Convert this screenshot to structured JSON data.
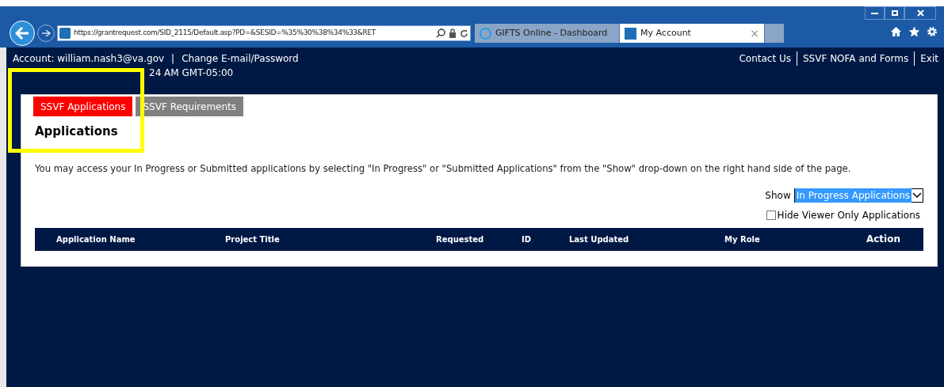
{
  "browser": {
    "url": "https://grantrequest.com/SID_2115/Default.asp?PD=&SESID=%35%30%38%34%33&RET",
    "tabs": [
      {
        "title": "GIFTS Online - Dashboard",
        "selected": false
      },
      {
        "title": "My Account",
        "selected": true
      }
    ],
    "close_tab": "×"
  },
  "header": {
    "account": "Account: william.nash3@va.gov",
    "separator": "|",
    "change_link": "Change E-mail/Password",
    "last_login": "24 AM GMT-05:00",
    "links": [
      "Contact Us",
      "SSVF NOFA and Forms",
      "Exit"
    ]
  },
  "tabs": [
    {
      "label": "SSVF Applications",
      "selected": true
    },
    {
      "label": "SSVF Requirements",
      "selected": false
    }
  ],
  "heading": "Applications",
  "instructions": "You may access your In Progress or Submitted applications by selecting \"In Progress\" or \"Submitted Applications\" from the \"Show\" drop-down on the right hand side of the page.",
  "show": {
    "label": "Show",
    "value": "In Progress Applications"
  },
  "hide_viewer": {
    "label": "Hide Viewer Only Applications",
    "checked": false
  },
  "table": {
    "columns": [
      "Application Name",
      "Project Title",
      "Requested",
      "ID",
      "Last Updated",
      "My Role",
      "Action"
    ]
  }
}
